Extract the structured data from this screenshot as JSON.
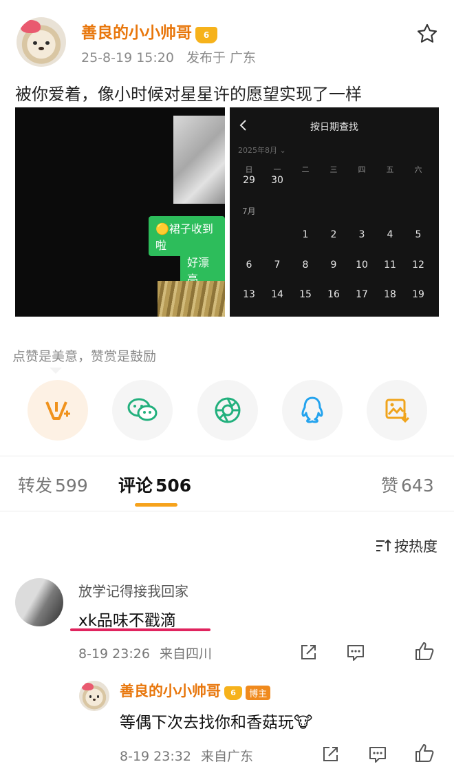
{
  "post": {
    "author": "善良的小小帅哥",
    "author_badge": "6",
    "timestamp": "25-8-19 15:20",
    "location": "发布于 广东",
    "text": "被你爱着，像小时候对星星许的愿望实现了一样"
  },
  "image_left": {
    "bubbles": [
      "🟡裙子收到啦",
      "好漂亮"
    ]
  },
  "image_right": {
    "title": "按日期查找",
    "month_selector": "2025年8月 ⌄",
    "weekdays": [
      "日",
      "一",
      "二",
      "三",
      "四",
      "五",
      "六"
    ],
    "row_prev": [
      "29",
      "30"
    ],
    "month_label": "7月",
    "row1": [
      "1",
      "2",
      "3",
      "4",
      "5"
    ],
    "row2": [
      "6",
      "7",
      "8",
      "9",
      "10",
      "11",
      "12"
    ],
    "row3": [
      "13",
      "14",
      "15",
      "16",
      "17",
      "18",
      "19"
    ]
  },
  "reward_tip": "点赞是美意，赞赏是鼓励",
  "share_icons": [
    "v-plus-icon",
    "wechat-icon",
    "moments-icon",
    "qq-icon",
    "save-image-icon"
  ],
  "tabs": {
    "repost_label": "转发",
    "repost_count": "599",
    "comment_label": "评论",
    "comment_count": "506",
    "like_label": "赞",
    "like_count": "643"
  },
  "sort": {
    "label": "按热度"
  },
  "comments": [
    {
      "name": "放学记得接我回家",
      "body": "xk品味不戳滴",
      "time": "8-19 23:26",
      "location": "来自四川"
    }
  ],
  "reply": {
    "name": "善良的小小帅哥",
    "badge_level": "6",
    "badge_host": "博主",
    "body": "等偶下次去找你和香菇玩🐮",
    "time": "8-19 23:32",
    "location": "来自广东"
  },
  "colors": {
    "accent": "#e8760b",
    "tab_underline": "#f6a21b",
    "highlight": "#e0245e",
    "wechat_green": "#2dbd5b",
    "qq_blue": "#23a3ee"
  }
}
